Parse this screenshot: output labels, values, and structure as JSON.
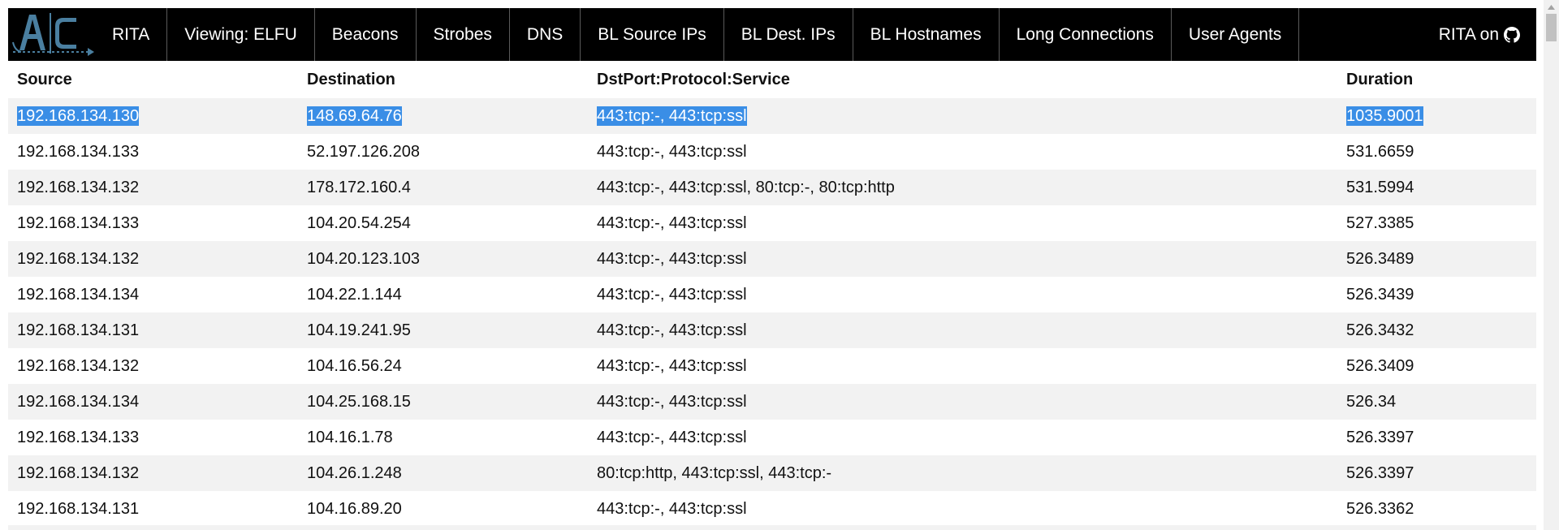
{
  "navbar": {
    "logo_icon": "ac-hunter-logo-icon",
    "items": [
      {
        "label": "RITA"
      },
      {
        "label": "Viewing: ELFU"
      },
      {
        "label": "Beacons"
      },
      {
        "label": "Strobes"
      },
      {
        "label": "DNS"
      },
      {
        "label": "BL Source IPs"
      },
      {
        "label": "BL Dest. IPs"
      },
      {
        "label": "BL Hostnames"
      },
      {
        "label": "Long Connections"
      },
      {
        "label": "User Agents"
      }
    ],
    "right_label": "RITA on",
    "right_icon": "github-icon"
  },
  "table": {
    "headers": [
      "Source",
      "Destination",
      "DstPort:Protocol:Service",
      "Duration"
    ],
    "rows": [
      {
        "source": "192.168.134.130",
        "destination": "148.69.64.76",
        "service": "443:tcp:-, 443:tcp:ssl",
        "duration": "1035.9001",
        "selected": true
      },
      {
        "source": "192.168.134.133",
        "destination": "52.197.126.208",
        "service": "443:tcp:-, 443:tcp:ssl",
        "duration": "531.6659"
      },
      {
        "source": "192.168.134.132",
        "destination": "178.172.160.4",
        "service": "443:tcp:-, 443:tcp:ssl, 80:tcp:-, 80:tcp:http",
        "duration": "531.5994"
      },
      {
        "source": "192.168.134.133",
        "destination": "104.20.54.254",
        "service": "443:tcp:-, 443:tcp:ssl",
        "duration": "527.3385"
      },
      {
        "source": "192.168.134.132",
        "destination": "104.20.123.103",
        "service": "443:tcp:-, 443:tcp:ssl",
        "duration": "526.3489"
      },
      {
        "source": "192.168.134.134",
        "destination": "104.22.1.144",
        "service": "443:tcp:-, 443:tcp:ssl",
        "duration": "526.3439"
      },
      {
        "source": "192.168.134.131",
        "destination": "104.19.241.95",
        "service": "443:tcp:-, 443:tcp:ssl",
        "duration": "526.3432"
      },
      {
        "source": "192.168.134.132",
        "destination": "104.16.56.24",
        "service": "443:tcp:-, 443:tcp:ssl",
        "duration": "526.3409"
      },
      {
        "source": "192.168.134.134",
        "destination": "104.25.168.15",
        "service": "443:tcp:-, 443:tcp:ssl",
        "duration": "526.34"
      },
      {
        "source": "192.168.134.133",
        "destination": "104.16.1.78",
        "service": "443:tcp:-, 443:tcp:ssl",
        "duration": "526.3397"
      },
      {
        "source": "192.168.134.132",
        "destination": "104.26.1.248",
        "service": "80:tcp:http, 443:tcp:ssl, 443:tcp:-",
        "duration": "526.3397"
      },
      {
        "source": "192.168.134.131",
        "destination": "104.16.89.20",
        "service": "443:tcp:-, 443:tcp:ssl",
        "duration": "526.3362"
      }
    ]
  },
  "colors": {
    "navbar_bg": "#000000",
    "row_stripe": "#f2f2f2",
    "selection": "#3a8ee6",
    "logo_accent": "#4a7fa0"
  }
}
